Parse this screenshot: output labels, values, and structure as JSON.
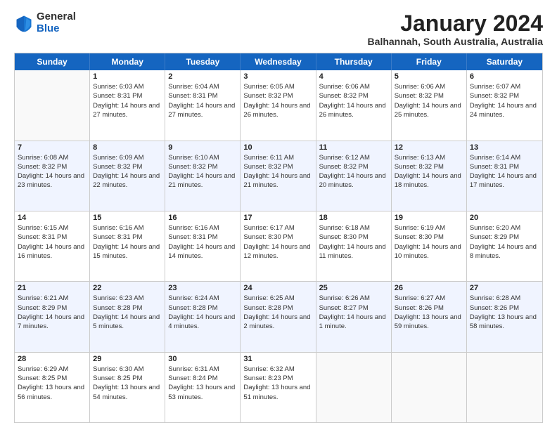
{
  "logo": {
    "general": "General",
    "blue": "Blue"
  },
  "title": "January 2024",
  "location": "Balhannah, South Australia, Australia",
  "days_of_week": [
    "Sunday",
    "Monday",
    "Tuesday",
    "Wednesday",
    "Thursday",
    "Friday",
    "Saturday"
  ],
  "rows": [
    [
      {
        "day": "",
        "empty": true
      },
      {
        "day": "1",
        "sunrise": "6:03 AM",
        "sunset": "8:31 PM",
        "daylight": "14 hours and 27 minutes."
      },
      {
        "day": "2",
        "sunrise": "6:04 AM",
        "sunset": "8:31 PM",
        "daylight": "14 hours and 27 minutes."
      },
      {
        "day": "3",
        "sunrise": "6:05 AM",
        "sunset": "8:32 PM",
        "daylight": "14 hours and 26 minutes."
      },
      {
        "day": "4",
        "sunrise": "6:06 AM",
        "sunset": "8:32 PM",
        "daylight": "14 hours and 26 minutes."
      },
      {
        "day": "5",
        "sunrise": "6:06 AM",
        "sunset": "8:32 PM",
        "daylight": "14 hours and 25 minutes."
      },
      {
        "day": "6",
        "sunrise": "6:07 AM",
        "sunset": "8:32 PM",
        "daylight": "14 hours and 24 minutes."
      }
    ],
    [
      {
        "day": "7",
        "sunrise": "6:08 AM",
        "sunset": "8:32 PM",
        "daylight": "14 hours and 23 minutes."
      },
      {
        "day": "8",
        "sunrise": "6:09 AM",
        "sunset": "8:32 PM",
        "daylight": "14 hours and 22 minutes."
      },
      {
        "day": "9",
        "sunrise": "6:10 AM",
        "sunset": "8:32 PM",
        "daylight": "14 hours and 21 minutes."
      },
      {
        "day": "10",
        "sunrise": "6:11 AM",
        "sunset": "8:32 PM",
        "daylight": "14 hours and 21 minutes."
      },
      {
        "day": "11",
        "sunrise": "6:12 AM",
        "sunset": "8:32 PM",
        "daylight": "14 hours and 20 minutes."
      },
      {
        "day": "12",
        "sunrise": "6:13 AM",
        "sunset": "8:32 PM",
        "daylight": "14 hours and 18 minutes."
      },
      {
        "day": "13",
        "sunrise": "6:14 AM",
        "sunset": "8:31 PM",
        "daylight": "14 hours and 17 minutes."
      }
    ],
    [
      {
        "day": "14",
        "sunrise": "6:15 AM",
        "sunset": "8:31 PM",
        "daylight": "14 hours and 16 minutes."
      },
      {
        "day": "15",
        "sunrise": "6:16 AM",
        "sunset": "8:31 PM",
        "daylight": "14 hours and 15 minutes."
      },
      {
        "day": "16",
        "sunrise": "6:16 AM",
        "sunset": "8:31 PM",
        "daylight": "14 hours and 14 minutes."
      },
      {
        "day": "17",
        "sunrise": "6:17 AM",
        "sunset": "8:30 PM",
        "daylight": "14 hours and 12 minutes."
      },
      {
        "day": "18",
        "sunrise": "6:18 AM",
        "sunset": "8:30 PM",
        "daylight": "14 hours and 11 minutes."
      },
      {
        "day": "19",
        "sunrise": "6:19 AM",
        "sunset": "8:30 PM",
        "daylight": "14 hours and 10 minutes."
      },
      {
        "day": "20",
        "sunrise": "6:20 AM",
        "sunset": "8:29 PM",
        "daylight": "14 hours and 8 minutes."
      }
    ],
    [
      {
        "day": "21",
        "sunrise": "6:21 AM",
        "sunset": "8:29 PM",
        "daylight": "14 hours and 7 minutes."
      },
      {
        "day": "22",
        "sunrise": "6:23 AM",
        "sunset": "8:28 PM",
        "daylight": "14 hours and 5 minutes."
      },
      {
        "day": "23",
        "sunrise": "6:24 AM",
        "sunset": "8:28 PM",
        "daylight": "14 hours and 4 minutes."
      },
      {
        "day": "24",
        "sunrise": "6:25 AM",
        "sunset": "8:28 PM",
        "daylight": "14 hours and 2 minutes."
      },
      {
        "day": "25",
        "sunrise": "6:26 AM",
        "sunset": "8:27 PM",
        "daylight": "14 hours and 1 minute."
      },
      {
        "day": "26",
        "sunrise": "6:27 AM",
        "sunset": "8:26 PM",
        "daylight": "13 hours and 59 minutes."
      },
      {
        "day": "27",
        "sunrise": "6:28 AM",
        "sunset": "8:26 PM",
        "daylight": "13 hours and 58 minutes."
      }
    ],
    [
      {
        "day": "28",
        "sunrise": "6:29 AM",
        "sunset": "8:25 PM",
        "daylight": "13 hours and 56 minutes."
      },
      {
        "day": "29",
        "sunrise": "6:30 AM",
        "sunset": "8:25 PM",
        "daylight": "13 hours and 54 minutes."
      },
      {
        "day": "30",
        "sunrise": "6:31 AM",
        "sunset": "8:24 PM",
        "daylight": "13 hours and 53 minutes."
      },
      {
        "day": "31",
        "sunrise": "6:32 AM",
        "sunset": "8:23 PM",
        "daylight": "13 hours and 51 minutes."
      },
      {
        "day": "",
        "empty": true
      },
      {
        "day": "",
        "empty": true
      },
      {
        "day": "",
        "empty": true
      }
    ]
  ],
  "labels": {
    "sunrise": "Sunrise:",
    "sunset": "Sunset:",
    "daylight": "Daylight:"
  }
}
